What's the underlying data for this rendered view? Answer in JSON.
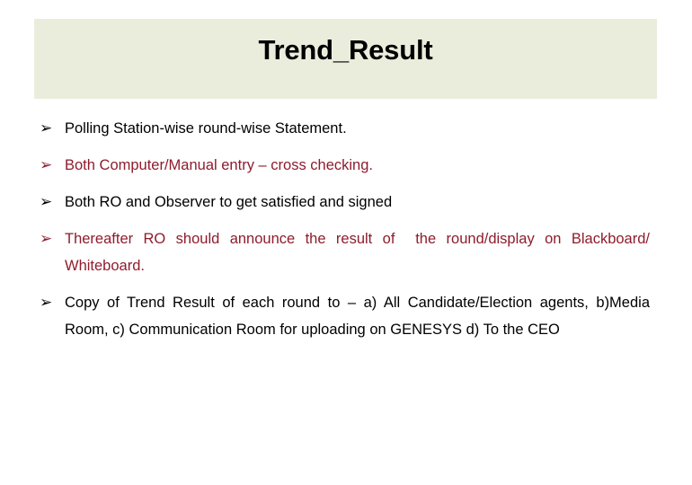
{
  "slide": {
    "title": "Trend_Result",
    "banner_color": "#eaeddc",
    "background_color": "#ffffff",
    "accent_red": "#8f1c2c",
    "text_black": "#000000",
    "bullet_glyph": "➢",
    "bullets": [
      {
        "text": "Polling Station-wise round-wise Statement.",
        "color": "#000000",
        "style": "left"
      },
      {
        "text": "Both Computer/Manual entry – cross checking.",
        "color": "#8f1c2c",
        "style": "left"
      },
      {
        "text": "Both RO and Observer to get satisfied and signed",
        "color": "#000000",
        "style": "left"
      },
      {
        "text": "Thereafter RO should announce the result of  the round/display on Blackboard/ Whiteboard.",
        "color": "#8f1c2c",
        "style": "justify"
      },
      {
        "text": "Copy of Trend Result of each round to – a) All Candidate/Election agents, b)Media Room, c) Communication Room for uploading on GENESYS d) To the CEO",
        "color": "#000000",
        "style": "justify"
      }
    ]
  }
}
